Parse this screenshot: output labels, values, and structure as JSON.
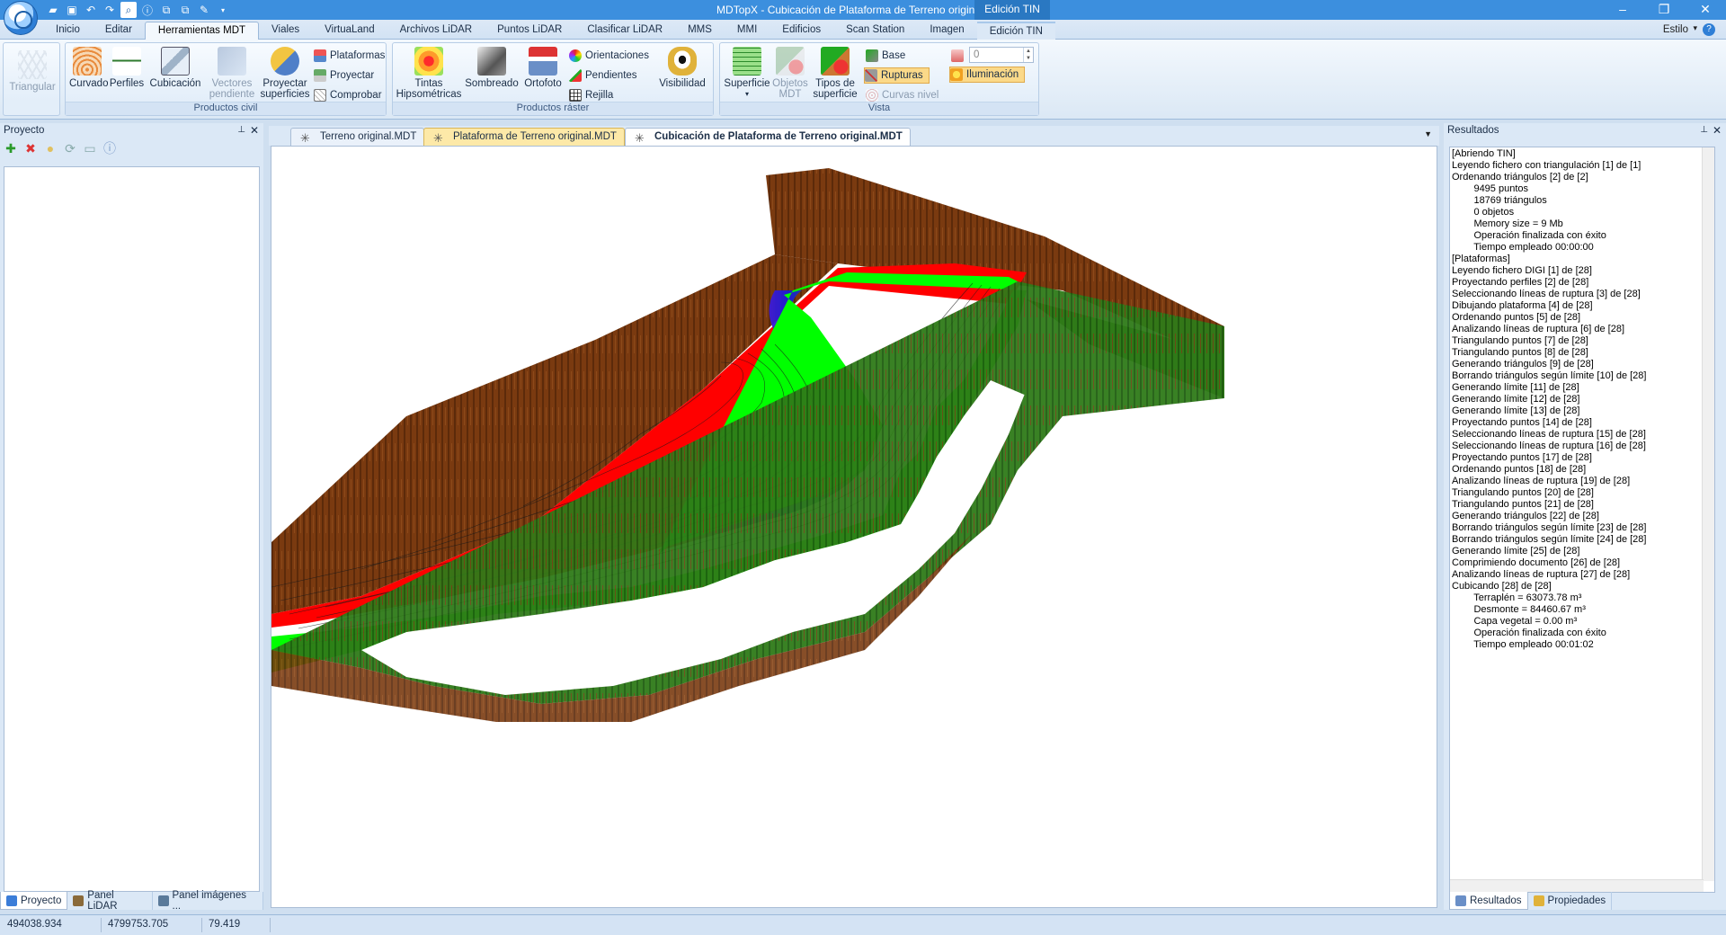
{
  "titlebar": {
    "title": "MDTopX - Cubicación de Plataforma de Terreno original.MDT",
    "context_label": "Edición TIN",
    "minimize_icon": "minimize-icon",
    "restore_icon": "restore-icon",
    "close_icon": "close-icon"
  },
  "tabs": [
    {
      "label": "Inicio"
    },
    {
      "label": "Editar"
    },
    {
      "label": "Herramientas MDT",
      "selected": true
    },
    {
      "label": "Viales"
    },
    {
      "label": "VirtuaLand"
    },
    {
      "label": "Archivos LiDAR"
    },
    {
      "label": "Puntos LiDAR"
    },
    {
      "label": "Clasificar LiDAR"
    },
    {
      "label": "MMS"
    },
    {
      "label": "MMI"
    },
    {
      "label": "Edificios"
    },
    {
      "label": "Scan Station"
    },
    {
      "label": "Imagen"
    },
    {
      "label": "Edición TIN",
      "context": true
    }
  ],
  "estilo": "Estilo",
  "ribbon": {
    "triangular": "Triangular",
    "civil": {
      "label": "Productos civil",
      "curvado": "Curvado",
      "perfiles": "Perfiles",
      "cubicacion": "Cubicación",
      "vectores": "Vectores pendiente",
      "proyectar_superficies": "Proyectar superficies",
      "plataformas": "Plataformas",
      "proyectar": "Proyectar",
      "comprobar": "Comprobar"
    },
    "raster": {
      "label": "Productos ráster",
      "tintas": "Tintas Hipsométricas",
      "sombreado": "Sombreado",
      "ortofoto": "Ortofoto",
      "orientaciones": "Orientaciones",
      "pendientes": "Pendientes",
      "rejilla": "Rejilla",
      "visibilidad": "Visibilidad"
    },
    "vista": {
      "label": "Vista",
      "superficie": "Superficie",
      "objetos_mdt": "Objetos MDT",
      "tipos_superficie": "Tipos de superficie",
      "base": "Base",
      "rupturas": "Rupturas",
      "curvas_nivel": "Curvas nivel"
    },
    "spin_value": "0",
    "iluminacion": "Iluminación"
  },
  "left_panel": {
    "title": "Proyecto",
    "bottom_tabs": [
      "Proyecto",
      "Panel LiDAR",
      "Panel imágenes ..."
    ]
  },
  "documents": [
    {
      "label": "Terreno original.MDT"
    },
    {
      "label": "Plataforma de Terreno original.MDT",
      "highlight": true
    },
    {
      "label": "Cubicación de Plataforma de Terreno original.MDT",
      "active": true
    }
  ],
  "results": {
    "title": "Resultados",
    "lines": [
      "[Abriendo TIN]",
      "Leyendo fichero con triangulación [1] de [1]",
      "Ordenando triángulos [2] de [2]",
      "        9495 puntos",
      "        18769 triángulos",
      "        0 objetos",
      "        Memory size = 9 Mb",
      "        Operación finalizada con éxito",
      "        Tiempo empleado 00:00:00",
      "[Plataformas]",
      "Leyendo fichero DIGI [1] de [28]",
      "Proyectando perfiles [2] de [28]",
      "Seleccionando líneas de ruptura [3] de [28]",
      "Dibujando plataforma [4] de [28]",
      "Ordenando puntos [5] de [28]",
      "Analizando líneas de ruptura [6] de [28]",
      "Triangulando puntos [7] de [28]",
      "Triangulando puntos [8] de [28]",
      "Generando triángulos [9] de [28]",
      "Borrando triángulos según límite [10] de [28]",
      "Generando límite [11] de [28]",
      "Generando límite [12] de [28]",
      "Generando límite [13] de [28]",
      "Proyectando puntos [14] de [28]",
      "Seleccionando líneas de ruptura [15] de [28]",
      "Seleccionando líneas de ruptura [16] de [28]",
      "Proyectando puntos [17] de [28]",
      "Ordenando puntos [18] de [28]",
      "Analizando líneas de ruptura [19] de [28]",
      "Triangulando puntos [20] de [28]",
      "Triangulando puntos [21] de [28]",
      "Generando triángulos [22] de [28]",
      "Borrando triángulos según límite [23] de [28]",
      "Borrando triángulos según límite [24] de [28]",
      "Generando límite [25] de [28]",
      "Comprimiendo documento [26] de [28]",
      "Analizando líneas de ruptura [27] de [28]",
      "Cubicando [28] de [28]",
      "        Terraplén = 63073.78 m³",
      "        Desmonte = 84460.67 m³",
      "        Capa vegetal = 0.00 m³",
      "        Operación finalizada con éxito",
      "        Tiempo empleado 00:01:02"
    ],
    "bottom_tabs": [
      "Resultados",
      "Propiedades"
    ]
  },
  "status": {
    "x": "494038.934",
    "y": "4799753.705",
    "z": "79.419"
  },
  "colors": {
    "titlebar": "#3c8fde",
    "desmonte": "#ff0000",
    "terraplen": "#00ff00",
    "talud": "#7a3a10",
    "transition": "#1a1ad6"
  }
}
